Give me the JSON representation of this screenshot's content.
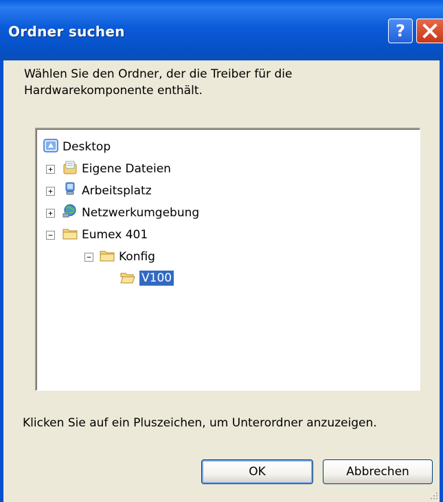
{
  "window": {
    "title": "Ordner suchen",
    "help_label": "?",
    "close_label": "✕"
  },
  "instruction": "Wählen Sie den Ordner, der die Treiber für die Hardwarekomponente enthält.",
  "tree": {
    "items": [
      {
        "label": "Desktop",
        "icon": "desktop-icon"
      },
      {
        "label": "Eigene Dateien",
        "icon": "my-documents-icon",
        "expander": "+"
      },
      {
        "label": "Arbeitsplatz",
        "icon": "my-computer-icon",
        "expander": "+"
      },
      {
        "label": "Netzwerkumgebung",
        "icon": "network-places-icon",
        "expander": "+"
      },
      {
        "label": "Eumex 401",
        "icon": "folder-icon",
        "expander": "−"
      },
      {
        "label": "Konfig",
        "icon": "folder-icon",
        "expander": "−"
      },
      {
        "label": "V100",
        "icon": "folder-open-icon",
        "selected": true
      }
    ]
  },
  "hint": "Klicken Sie auf ein Pluszeichen, um Unterordner anzuzeigen.",
  "buttons": {
    "ok": "OK",
    "cancel": "Abbrechen"
  },
  "colors": {
    "titlebar": "#0a5fe0",
    "selection": "#316ac5",
    "dialog_bg": "#ece9d8"
  }
}
